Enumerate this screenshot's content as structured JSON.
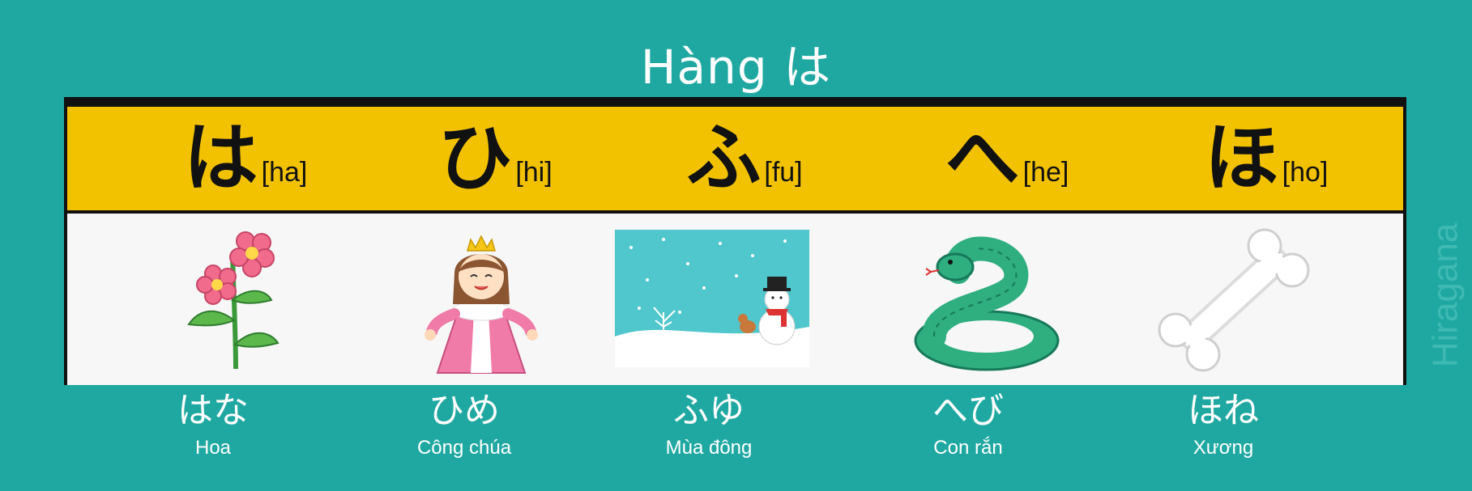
{
  "title": "Hàng は",
  "side_label": "Hiragana",
  "columns": [
    {
      "kana": "は",
      "romaji": "[ha]",
      "word": "はな",
      "meaning": "Hoa",
      "picture_icon": "flower-icon"
    },
    {
      "kana": "ひ",
      "romaji": "[hi]",
      "word": "ひめ",
      "meaning": "Công chúa",
      "picture_icon": "princess-icon"
    },
    {
      "kana": "ふ",
      "romaji": "[fu]",
      "word": "ふゆ",
      "meaning": "Mùa đông",
      "picture_icon": "winter-snowman-icon"
    },
    {
      "kana": "へ",
      "romaji": "[he]",
      "word": "へび",
      "meaning": "Con rắn",
      "picture_icon": "snake-icon"
    },
    {
      "kana": "ほ",
      "romaji": "[ho]",
      "word": "ほね",
      "meaning": "Xương",
      "picture_icon": "bone-icon"
    }
  ],
  "colors": {
    "background": "#1fa8a1",
    "header_band": "#f2c200",
    "board": "#f7f7f7",
    "border": "#111111"
  }
}
